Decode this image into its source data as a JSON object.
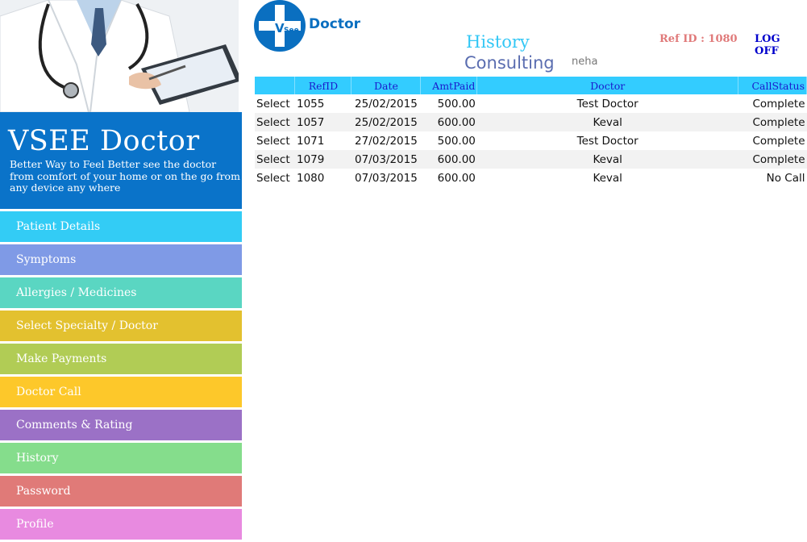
{
  "brand": {
    "title": "VSEE Doctor",
    "tagline": "Better Way to Feel Better see the doctor from comfort of your home or on the go from any device any where"
  },
  "nav": [
    {
      "label": "Patient Details",
      "color": "#33ccf5"
    },
    {
      "label": "Symptoms",
      "color": "#7f9ae6"
    },
    {
      "label": "Allergies / Medicines",
      "color": "#5ad6c2"
    },
    {
      "label": "Select Specialty / Doctor",
      "color": "#e3c12f"
    },
    {
      "label": "Make Payments",
      "color": "#b1cc55"
    },
    {
      "label": "Doctor Call",
      "color": "#fdc82a"
    },
    {
      "label": "Comments & Rating",
      "color": "#9b71c6"
    },
    {
      "label": "History",
      "color": "#85dd8c"
    },
    {
      "label": "Password",
      "color": "#e07a78"
    },
    {
      "label": "Profile",
      "color": "#e88ae0"
    }
  ],
  "header": {
    "logo_mark": "V",
    "logo_small": "See",
    "logo_text": "Doctor",
    "history": "History",
    "consulting": "Consulting",
    "username": "neha",
    "ref_id": "Ref ID : 1080",
    "logoff": "LOG OFF"
  },
  "table": {
    "columns": [
      "",
      "RefID",
      "Date",
      "AmtPaid",
      "Doctor",
      "CallStatus"
    ],
    "select_label": "Select",
    "rows": [
      {
        "refid": "1055",
        "date": "25/02/2015",
        "amt": "500.00",
        "doctor": "Test Doctor",
        "status": "Complete"
      },
      {
        "refid": "1057",
        "date": "25/02/2015",
        "amt": "600.00",
        "doctor": "Keval",
        "status": "Complete"
      },
      {
        "refid": "1071",
        "date": "27/02/2015",
        "amt": "500.00",
        "doctor": "Test Doctor",
        "status": "Complete"
      },
      {
        "refid": "1079",
        "date": "07/03/2015",
        "amt": "600.00",
        "doctor": "Keval",
        "status": "Complete"
      },
      {
        "refid": "1080",
        "date": "07/03/2015",
        "amt": "600.00",
        "doctor": "Keval",
        "status": "No Call"
      }
    ]
  }
}
